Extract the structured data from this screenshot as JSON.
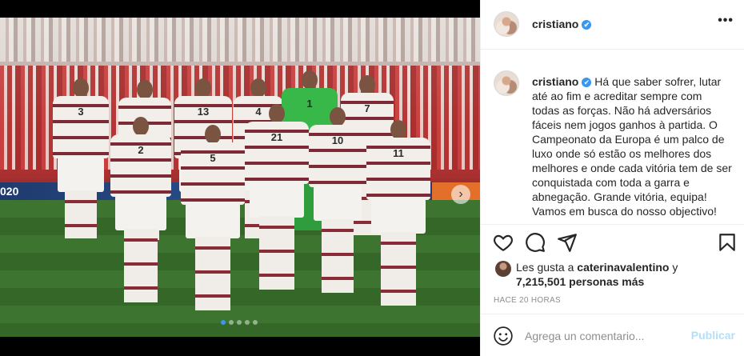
{
  "post": {
    "photo": {
      "banner_text": "020",
      "carousel_dots": 5,
      "active_dot": 0,
      "player_numbers": {
        "back_row": [
          "3",
          "",
          "13",
          "4",
          "1",
          "7"
        ],
        "front_row": [
          "",
          "2",
          "5",
          "21",
          "10",
          "11"
        ]
      }
    },
    "header": {
      "username": "cristiano",
      "verified_icon": "✔",
      "more_label": "•••"
    },
    "caption": {
      "username": "cristiano",
      "verified_icon": "✔",
      "text": "Há que saber sofrer, lutar até ao fim e acreditar sempre com todas as forças. Não há adversários fáceis nem jogos ganhos à partida. O Campeonato da Europa é um palco de luxo onde só estão os melhores dos melhores e onde cada vitória tem de ser conquistada com toda a garra e abnegação. Grande vitória, equipa! Vamos em busca do nosso objectivo!"
    },
    "actions": {
      "icons": [
        "heart-icon",
        "comment-icon",
        "share-icon",
        "bookmark-icon"
      ]
    },
    "likes": {
      "prefix": "Les gusta a ",
      "liked_by": "caterinavalentino",
      "connector": " y",
      "count_text": "7,215,501 personas más"
    },
    "timestamp": "HACE 20 HORAS",
    "comment": {
      "placeholder": "Agrega un comentario...",
      "post_label": "Publicar"
    },
    "colors": {
      "accent": "#3897f0",
      "post_button": "#b2dffc",
      "text": "#262626",
      "muted": "#8e8e8e"
    }
  }
}
